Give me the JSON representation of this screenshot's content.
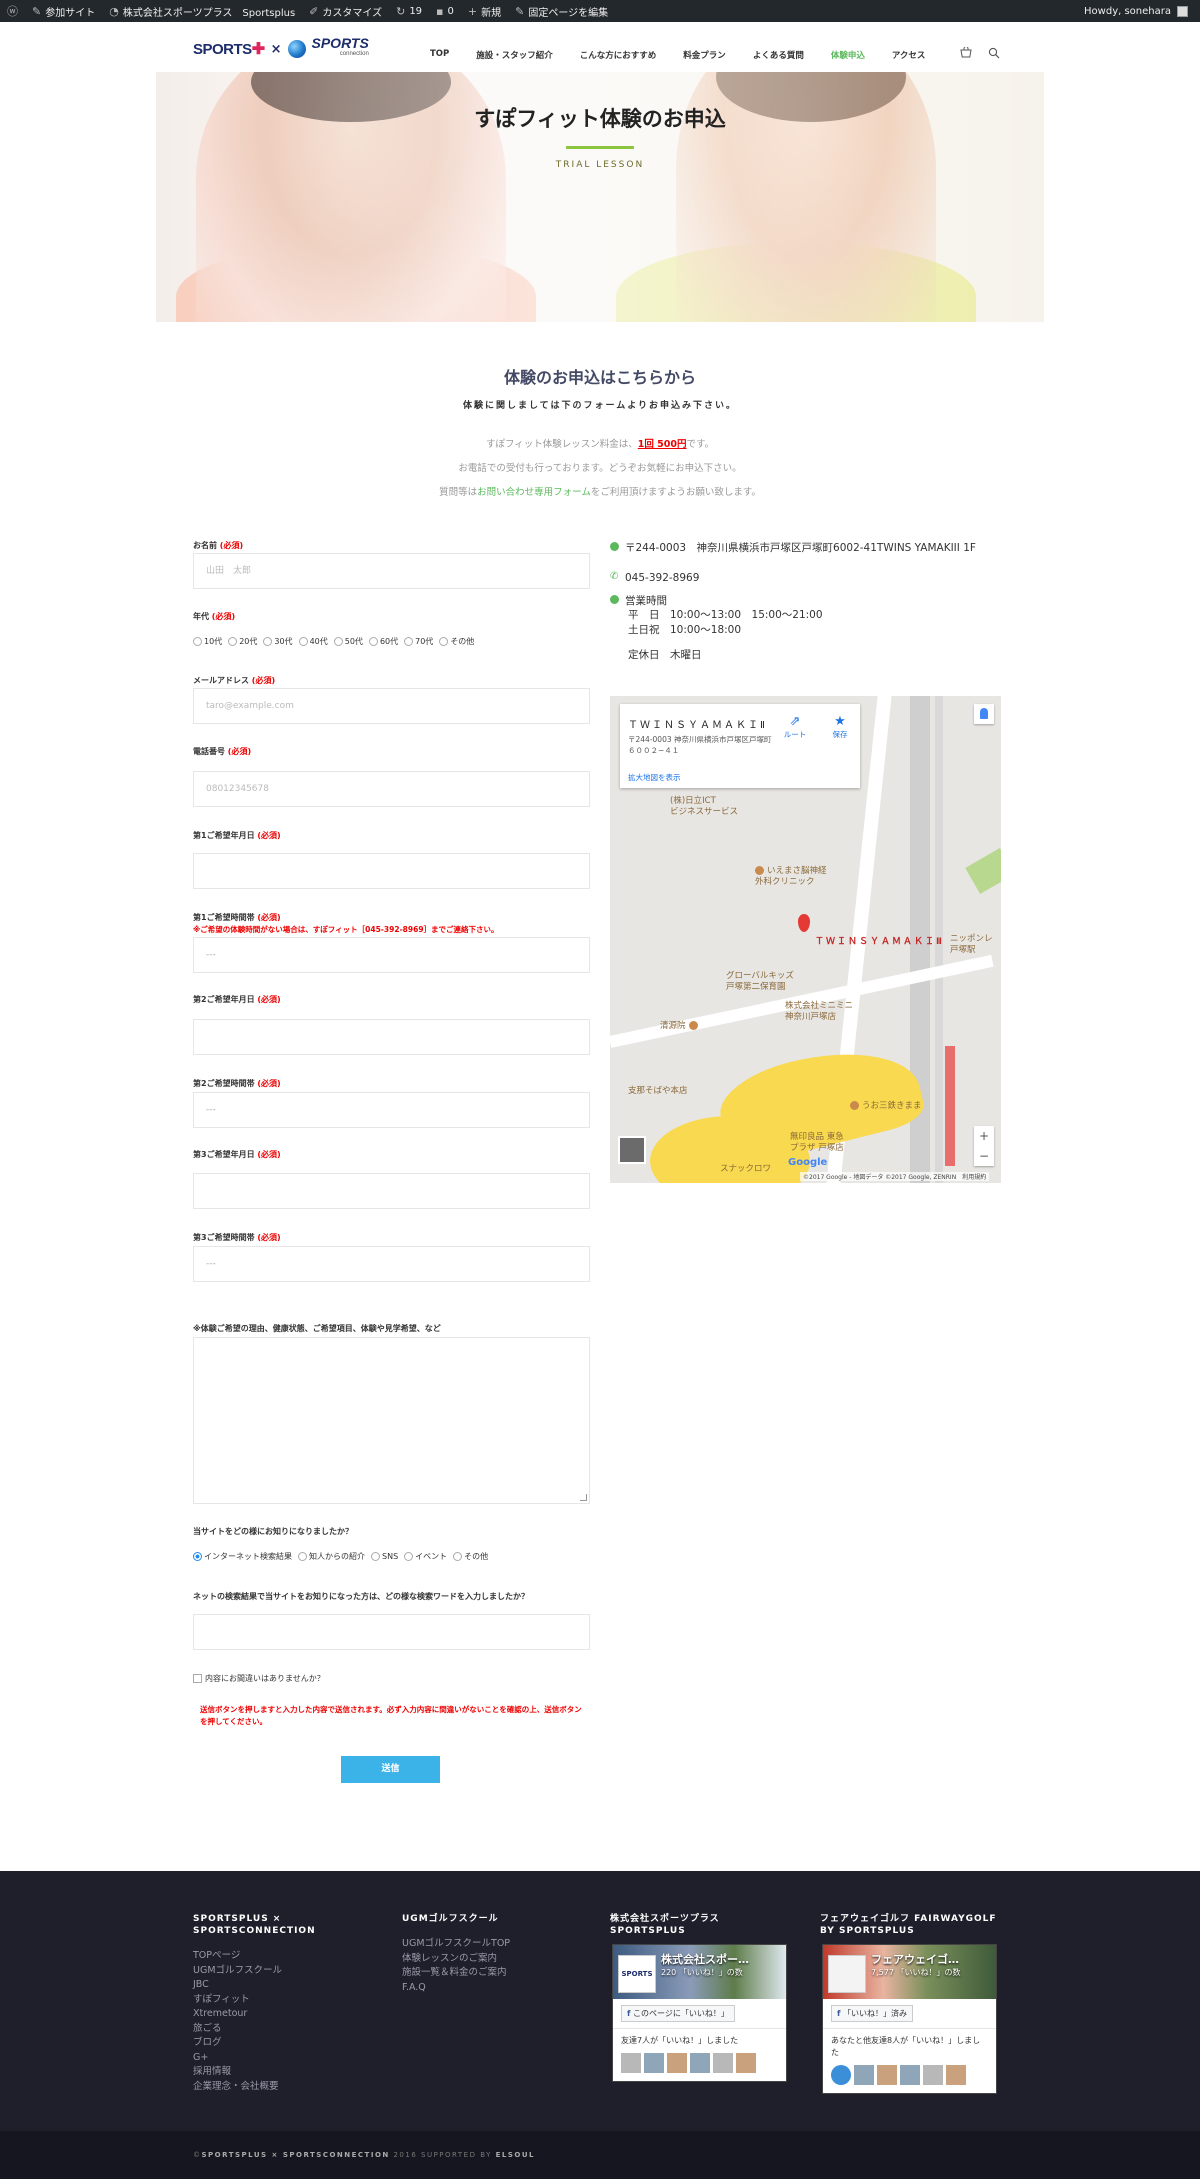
{
  "adminbar": {
    "items": [
      "参加サイト",
      "株式会社スポーツプラス　Sportsplus",
      "カスタマイズ",
      "19",
      "0",
      "新規",
      "固定ページを編集"
    ],
    "howdy": "Howdy, sonehara"
  },
  "header": {
    "logo_left": "SPORTS",
    "logo_x": "×",
    "logo_right": "SPORTS",
    "logo_right_small": "connection",
    "nav": [
      "TOP",
      "施設・スタッフ紹介",
      "こんな方におすすめ",
      "料金プラン",
      "よくある質問",
      "体験申込",
      "アクセス"
    ],
    "active_index": 5
  },
  "hero": {
    "title": "すぽフィット体験のお申込",
    "subtitle": "TRIAL LESSON"
  },
  "intro": {
    "title": "体験のお申込はこちらから",
    "sub": "体験に関しましては下のフォームよりお申込み下さい。",
    "line1_pre": "すぽフィット体験レッスン料金は、",
    "line1_price": "1回 500円",
    "line1_post": "です。",
    "line2": "お電話での受付も行っております。どうぞお気軽にお申込下さい。",
    "line3_pre": "質問等は",
    "line3_link": "お問い合わせ専用フォーム",
    "line3_post": "をご利用頂けますようお願い致します。"
  },
  "form": {
    "required": "(必須)",
    "name_label": "お名前",
    "name_placeholder": "山田　太郎",
    "age_label": "年代",
    "age_options": [
      "10代",
      "20代",
      "30代",
      "40代",
      "50代",
      "60代",
      "70代",
      "その他"
    ],
    "email_label": "メールアドレス",
    "email_placeholder": "taro@example.com",
    "tel_label": "電話番号",
    "tel_placeholder": "08012345678",
    "date1_label": "第1ご希望年月日",
    "time1_label": "第1ご希望時間帯",
    "time1_note": "※ご希望の体験時間がない場合は、すぽフィット［045-392-8969］までご連絡下さい。",
    "date2_label": "第2ご希望年月日",
    "time2_label": "第2ご希望時間帯",
    "date3_label": "第3ご希望年月日",
    "time3_label": "第3ご希望時間帯",
    "select_placeholder": "---",
    "message_label": "※体験ご希望の理由、健康状態、ご希望項目、体験や見学希望、など",
    "source_label": "当サイトをどの様にお知りになりましたか？",
    "source_options": [
      "インターネット検索結果",
      "知人からの紹介",
      "SNS",
      "イベント",
      "その他"
    ],
    "keyword_label": "ネットの検索結果で当サイトをお知りになった方は、どの様な検索ワードを入力しましたか？",
    "confirm_label": "内容にお間違いはありませんか？",
    "warning": "送信ボタンを押しますと入力した内容で送信されます。必ず入力内容に間違いがないことを確認の上、送信ボタンを押してください。",
    "submit": "送信"
  },
  "info": {
    "address": "〒244-0003　神奈川県横浜市戸塚区戸塚町6002-41TWINS YAMAKIII 1F",
    "phone": "045-392-8969",
    "hours_title": "営業時間",
    "hours_weekday": "平　日　10:00〜13:00　15:00〜21:00",
    "hours_weekend": "土日祝　10:00〜18:00",
    "closed": "定休日　木曜日"
  },
  "map": {
    "place": "ＴＷＩＮＳＹＡＭＡＫＩⅡ",
    "address": "〒244-0003 神奈川県横浜市戸塚区戸塚町６００２−４１",
    "route": "ルート",
    "save": "保存",
    "enlarge": "拡大地図を表示",
    "pin_label": "ＴＷＩＮＳＹＡＭＡＫＩⅡ",
    "poi1": "(株)日立ICT\nビジネスサービス",
    "poi2": "いえまさ脳神経\n外科クリニック",
    "poi3": "グローバルキッズ\n戸塚第二保育園",
    "poi4": "株式会社ミニミニ\n神奈川戸塚店",
    "poi5": "清源院",
    "poi6": "支那そばや本店",
    "poi7": "無印良品 東急\nプラザ 戸塚店",
    "poi8": "うお三鉄きまま",
    "poi9": "スナックロワ",
    "poi10": "ニッポンレ\n戸塚駅",
    "copyright": "©2017 Google - 地図データ ©2017 Google, ZENRIN　利用規約",
    "google": "Google"
  },
  "footer": {
    "col1_title": "SPORTSPLUS × SPORTSCONNECTION",
    "col1_links": [
      "TOPページ",
      "UGMゴルフスクール",
      "JBC",
      "すぽフィット",
      "Xtremetour",
      "旅ごる",
      "ブログ",
      "G+",
      "採用情報",
      "企業理念・会社概要"
    ],
    "col2_title": "UGMゴルフスクール",
    "col2_links": [
      "UGMゴルフスクールTOP",
      "体験レッスンのご案内",
      "施設一覧＆料金のご案内",
      "F.A.Q"
    ],
    "col3_title": "株式会社スポーツプラス SPORTSPLUS",
    "col3_fb_name": "株式会社スポー…",
    "col3_fb_likes": "220 「いいね！」の数",
    "col3_fb_btn": "このページに「いいね！」",
    "col3_fb_friends": "友達7人が「いいね！」しました",
    "col4_title": "フェアウェイゴルフ FAIRWAYGOLF BY SPORTSPLUS",
    "col4_fb_name": "フェアウェイゴ…",
    "col4_fb_likes": "7,577 「いいね！」の数",
    "col4_fb_btn": "「いいね！」済み",
    "col4_fb_friends": "あなたと他友達8人が「いいね！」しました",
    "copyright_pre": "©",
    "copyright_brand": "SPORTSPLUS × SPORTSCONNECTION",
    "copyright_mid": " 2016 SUPPORTED BY ",
    "copyright_sup": "ELSOUL"
  }
}
